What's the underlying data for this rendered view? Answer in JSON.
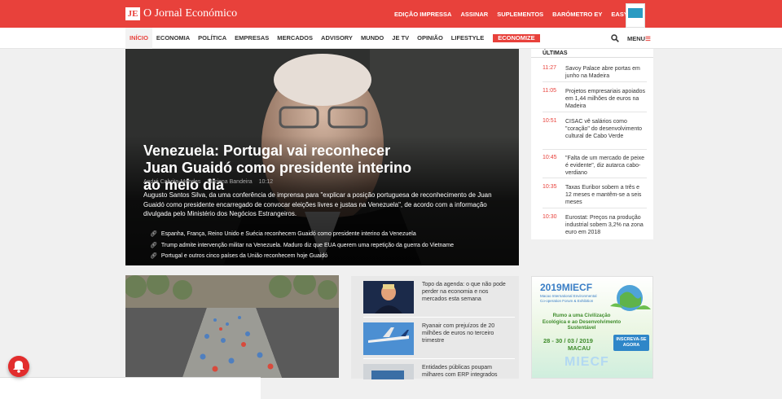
{
  "logo": {
    "mark": "JE",
    "text": "O Jornal Económico"
  },
  "top_links": [
    "EDIÇÃO IMPRESSA",
    "ASSINAR",
    "SUPLEMENTOS",
    "BARÓMETRO EY",
    "EASY TAX"
  ],
  "nav": {
    "items": [
      "INÍCIO",
      "ECONOMIA",
      "POLÍTICA",
      "EMPRESAS",
      "MERCADOS",
      "ADVISORY",
      "MUNDO",
      "JE TV",
      "OPINIÃO",
      "LIFESTYLE"
    ],
    "active": "INÍCIO",
    "economize": "ECONOMIZE",
    "menu_label": "MENU",
    "menu_bars": "☰"
  },
  "hero": {
    "headline": "Venezuela: Portugal vai reconhecer Juan Guaidó como presidente interino ao meio dia",
    "authors": [
      "André Cabrita-Mendes",
      "Mariana Bandeira",
      "10:12"
    ],
    "lead": "Augusto Santos Silva, da uma conferência de imprensa para \"explicar a posição portuguesa de reconhecimento de Juan Guaidó como presidente encarregado de convocar eleições livres e justas na Venezuela\", de acordo com a informação divulgada pelo Ministério dos Negócios Estrangeiros.",
    "related": [
      "Espanha, França, Reino Unido e Suécia reconhecem Guaidó como presidente interino da Venezuela",
      "Trump admite intervenção militar na Venezuela. Maduro diz que EUA querem uma repetição da guerra do Vietname",
      "Portugal e outros cinco países da União reconhecem hoje Guaidó"
    ]
  },
  "sidebar": {
    "title": "ÚLTIMAS",
    "items": [
      {
        "time": "11:27",
        "text": "Savoy Palace abre portas em junho na Madeira"
      },
      {
        "time": "11:05",
        "text": "Projetos empresariais apoiados em 1,44 milhões de euros na Madeira"
      },
      {
        "time": "10:51",
        "text": "CISAC vê salários como \"coração\" do desenvolvimento cultural de Cabo Verde"
      },
      {
        "time": "10:45",
        "text": "\"Falta de um mercado de peixe é evidente\", diz autarca cabo-verdiano"
      },
      {
        "time": "10:35",
        "text": "Taxas Euribor sobem a três e 12 meses e mantêm-se a seis meses"
      },
      {
        "time": "10:30",
        "text": "Eurostat: Preços na produção industrial sobem 3,2% na zona euro em 2018"
      }
    ]
  },
  "cards": [
    {
      "text": "Topo da agenda: o que não pode perder na economia e nos mercados esta semana"
    },
    {
      "text": "Ryanair com prejuízos de 20 milhões de euros no terceiro trimestre"
    },
    {
      "text": "Entidades públicas poupam milhares com ERP integrados"
    }
  ],
  "ad": {
    "title": "2019MIECF",
    "subtitle": "Macao International Environmental Co-operation Forum & Exhibition",
    "tagline": "Rumo a uma Civilização Ecológica e ao Desenvolvimento Sustentável",
    "dates": "28 - 30 / 03 / 2019",
    "city": "MACAU",
    "cta": "INSCREVA-SE AGORA",
    "big": "MIECF"
  },
  "colors": {
    "brand_red": "#e8413b",
    "background": "#f0f0f0"
  }
}
